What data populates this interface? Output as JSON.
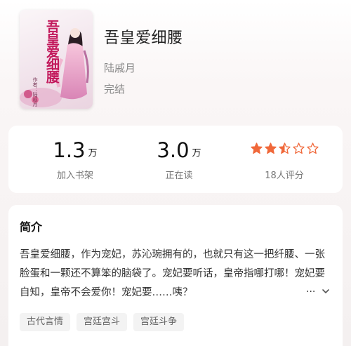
{
  "book": {
    "cover_title": "吾皇爱细腰",
    "cover_author": "作者：陆戚月",
    "title": "吾皇爱细腰",
    "author": "陆戚月",
    "status": "完结"
  },
  "stats": {
    "shelf": {
      "value": "1.3",
      "unit": "万",
      "label": "加入书架"
    },
    "reading": {
      "value": "3.0",
      "unit": "万",
      "label": "正在读"
    },
    "rating": {
      "stars": 2.5,
      "max": 5,
      "label": "18人评分",
      "color": "#f0683a"
    }
  },
  "intro": {
    "heading": "简介",
    "text": "吾皇爱细腰，作为宠妃，苏沁琬拥有的，也就只有这一把纤腰、一张脸蛋和一颗还不算笨的脑袋了。宠妃要听话，皇帝指哪打哪！宠妃要自知，皇帝不会爱你！宠妃要……咦？",
    "ellipsis": "...",
    "expand_icon": "chevron-down-icon",
    "tags": [
      "古代言情",
      "宫廷宫斗",
      "宫廷斗争"
    ]
  }
}
